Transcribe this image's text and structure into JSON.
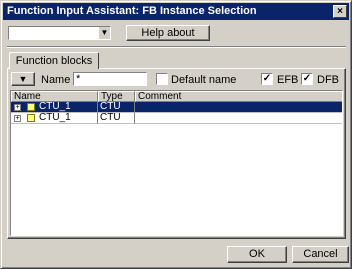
{
  "window": {
    "title": "Function Input Assistant: FB Instance Selection",
    "close_glyph": "×"
  },
  "top": {
    "combo_value": "",
    "combo_arrow": "▼",
    "help_label": "Help about"
  },
  "tabs": [
    {
      "label": "Function blocks",
      "active": true
    }
  ],
  "filter": {
    "button_glyph": "▼",
    "name_label": "Name",
    "name_value": "*",
    "default_name_label": "Default name",
    "default_name_checked": false,
    "efb_label": "EFB",
    "efb_checked": true,
    "dfb_label": "DFB",
    "dfb_checked": true,
    "check_glyph": "✓"
  },
  "table": {
    "columns": [
      "Name",
      "Type",
      "Comment"
    ],
    "rows": [
      {
        "expander": "+",
        "name": "CTU_1",
        "type": "CTU",
        "comment": "",
        "selected": true
      },
      {
        "expander": "+",
        "name": "CTU_1",
        "type": "CTU",
        "comment": "",
        "selected": false
      }
    ]
  },
  "footer": {
    "ok_label": "OK",
    "cancel_label": "Cancel"
  },
  "colors": {
    "title_bar": "#0a246a",
    "selection": "#0a246a",
    "face": "#d4d0c8",
    "fb_icon": "#ffff80"
  }
}
